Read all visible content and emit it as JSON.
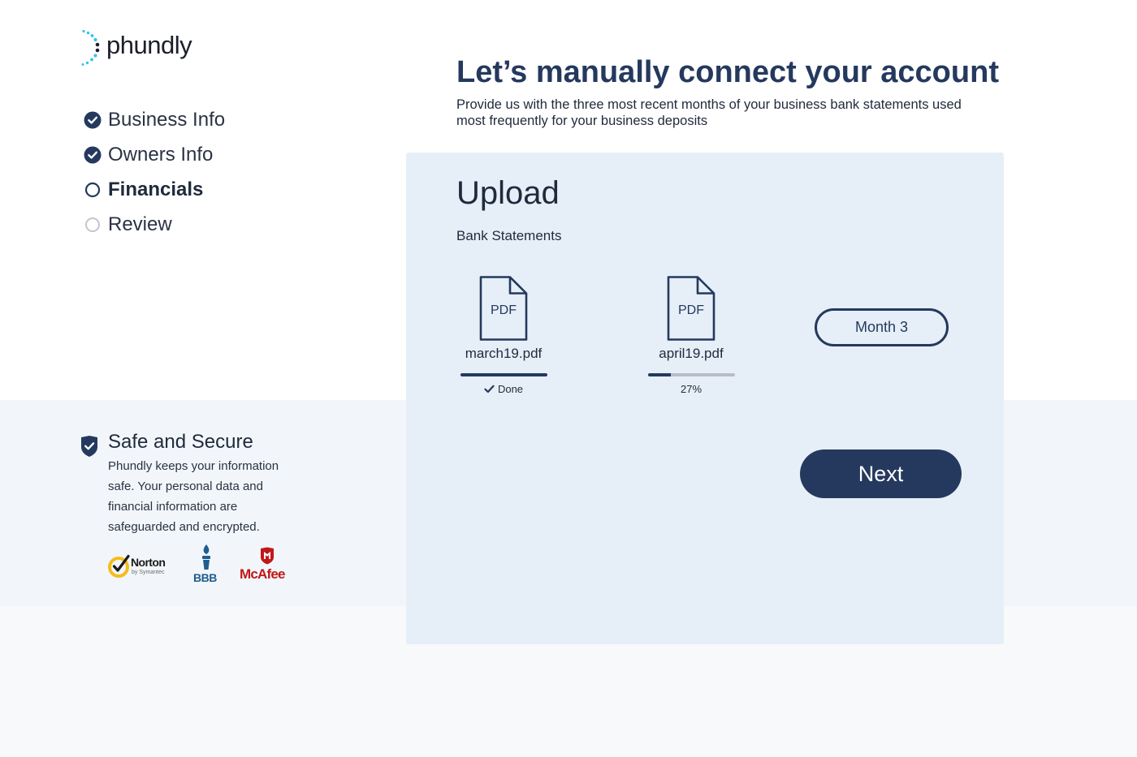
{
  "brand": {
    "name": "phundly",
    "logo_icon": "dotted-arc-icon",
    "dot_color": "#35c4e8"
  },
  "colors": {
    "navy": "#25395e",
    "card_bg": "#e6eff7",
    "progress_track": "#b9bec6",
    "norton_yellow": "#f4bd19",
    "bbb_blue": "#1f5d8d",
    "mcafee_red": "#c01818"
  },
  "steps": [
    {
      "label": "Business Info",
      "state": "complete",
      "icon": "check-circle-icon"
    },
    {
      "label": "Owners Info",
      "state": "complete",
      "icon": "check-circle-icon"
    },
    {
      "label": "Financials",
      "state": "current",
      "icon": "open-circle-icon"
    },
    {
      "label": "Review",
      "state": "upcoming",
      "icon": "empty-circle-icon"
    }
  ],
  "header": {
    "title": "Let’s manually connect your account",
    "subtitle": "Provide us with the three most recent months of your business bank statements used most frequently for your business deposits"
  },
  "upload": {
    "title": "Upload",
    "subtitle": "Bank Statements",
    "files": [
      {
        "icon_label": "PDF",
        "name": "march19.pdf",
        "progress": 1.0,
        "status": "Done",
        "status_icon": "checkmark-icon"
      },
      {
        "icon_label": "PDF",
        "name": "april19.pdf",
        "progress": 0.27,
        "status": "27%"
      }
    ],
    "month_button": "Month 3",
    "next_button": "Next"
  },
  "security": {
    "icon": "shield-check-icon",
    "title": "Safe and Secure",
    "text": "Phundly keeps your information safe. Your personal data and financial information are safeguarded and encrypted.",
    "badges": {
      "norton": {
        "name": "Norton",
        "sub": "by Symantec",
        "icon": "norton-check-icon"
      },
      "bbb": {
        "name": "BBB",
        "icon": "bbb-torch-icon"
      },
      "mcafee": {
        "name": "McAfee",
        "icon": "mcafee-shield-icon"
      }
    }
  }
}
